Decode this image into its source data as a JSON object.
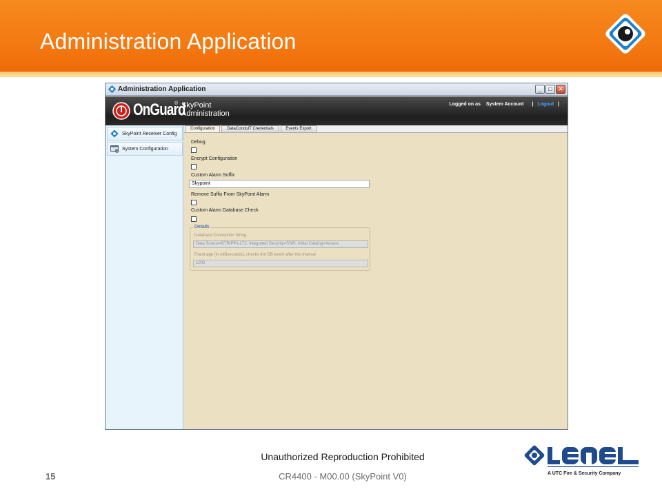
{
  "slide": {
    "title": "Administration Application",
    "footer_notice": "Unauthorized Reproduction Prohibited",
    "page_number": "15",
    "doc_id": "CR4400 - M00.00 (SkyPoint V0)",
    "brand_tagline": "A UTC Fire & Security Company",
    "colors": {
      "header_orange": "#f47a12",
      "lenel_blue": "#1f4b8e"
    }
  },
  "window": {
    "title": "Administration Application",
    "buttons": {
      "minimize": "_",
      "maximize": "□",
      "close": "✕"
    }
  },
  "app_header": {
    "brand": "OnGuard",
    "registered": "®",
    "product_line1": "SkyPoint",
    "product_line2": "Administration",
    "logged_on_label": "Logged on as",
    "account": "System Account",
    "separator": "|",
    "logout": "Logout",
    "separator2": "|"
  },
  "sidebar": {
    "items": [
      {
        "label": "SkyPoint Receiver Config",
        "icon": "receiver-icon"
      },
      {
        "label": "System Configuration",
        "icon": "system-config-icon"
      }
    ]
  },
  "tabs": [
    {
      "label": "Configuration",
      "active": true
    },
    {
      "label": "DataConduIT Credentials",
      "active": false
    },
    {
      "label": "Events Export",
      "active": false
    }
  ],
  "form": {
    "debug_label": "Debug",
    "debug_checked": false,
    "encrypt_label": "Encrypt Configuration",
    "encrypt_checked": false,
    "suffix_label": "Custom Alarm Suffix",
    "suffix_value": "Skypoint",
    "remove_suffix_label": "Remove Suffix From SkyPoint Alarm",
    "remove_suffix_checked": false,
    "db_check_label": "Custom Alarm Database Check",
    "db_check_checked": false,
    "details": {
      "title": "Details",
      "conn_label": "Database Connection String",
      "conn_value": "Data Source=BTRIPP1-LT2; Integrated Security=SSPI; Initial Catalog=Access",
      "age_label": "Event age (in milliseconds), checks the DB event after this interval",
      "age_value": "1000"
    }
  }
}
